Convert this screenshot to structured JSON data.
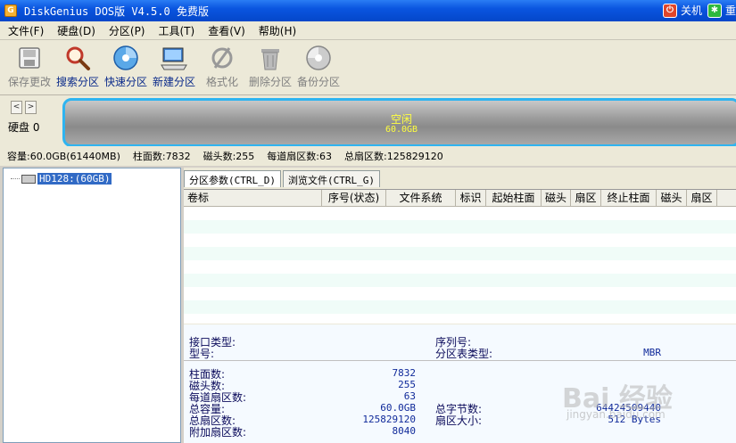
{
  "titlebar": {
    "app_icon": "G",
    "title": "DiskGenius DOS版 V4.5.0 免费版",
    "shutdown_label": "关机",
    "restart_label": "重"
  },
  "menu": [
    "文件(F)",
    "硬盘(D)",
    "分区(P)",
    "工具(T)",
    "查看(V)",
    "帮助(H)"
  ],
  "toolbar": [
    {
      "label": "保存更改",
      "icon": "save-icon",
      "enabled": false
    },
    {
      "label": "搜索分区",
      "icon": "magnifier-icon",
      "enabled": true
    },
    {
      "label": "快速分区",
      "icon": "disc-icon",
      "enabled": true
    },
    {
      "label": "新建分区",
      "icon": "computer-icon",
      "enabled": true
    },
    {
      "label": "格式化",
      "icon": "format-icon",
      "enabled": false
    },
    {
      "label": "删除分区",
      "icon": "trash-icon",
      "enabled": false
    },
    {
      "label": "备份分区",
      "icon": "backup-disc-icon",
      "enabled": false
    }
  ],
  "disk_nav": {
    "prev": "<",
    "next": ">",
    "disk_label": "硬盘 0"
  },
  "partition": {
    "name": "空闲",
    "size": "60.0GB"
  },
  "disk_info": {
    "capacity": "容量:60.0GB(61440MB)",
    "cylinders": "柱面数:7832",
    "heads": "磁头数:255",
    "sectors_per_track": "每道扇区数:63",
    "total_sectors": "总扇区数:125829120"
  },
  "tree": {
    "node_label": "HD128:(60GB)"
  },
  "tabs": [
    "分区参数(CTRL_D)",
    "浏览文件(CTRL_G)"
  ],
  "table_columns": [
    "卷标",
    "序号(状态)",
    "文件系统",
    "标识",
    "起始柱面",
    "磁头",
    "扇区",
    "终止柱面",
    "磁头",
    "扇区"
  ],
  "details_top": {
    "interface_label": "接口类型:",
    "model_label": "型号:",
    "serial_label": "序列号:",
    "table_type_label": "分区表类型:",
    "table_type_value": "MBR"
  },
  "details": [
    {
      "label": "柱面数:",
      "value": "7832"
    },
    {
      "label": "磁头数:",
      "value": "255"
    },
    {
      "label": "每道扇区数:",
      "value": "63"
    },
    {
      "label": "总容量:",
      "value": "60.0GB"
    },
    {
      "label": "总扇区数:",
      "value": "125829120"
    },
    {
      "label": "附加扇区数:",
      "value": "8040"
    }
  ],
  "details_right": [
    {
      "label": "总字节数:",
      "value": "64424509440"
    },
    {
      "label": "扇区大小:",
      "value": "512 Bytes"
    }
  ],
  "watermark": {
    "text": "Bai 经验",
    "sub": "jingyan.baidu.com"
  }
}
